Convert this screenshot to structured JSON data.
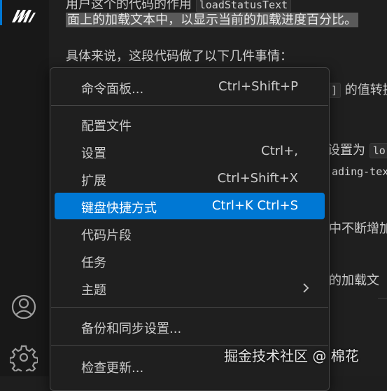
{
  "editor": {
    "line1_prefix": "用户这个的代码的作用",
    "line1_code": "loadStatusText",
    "line1_suffix": "",
    "line2": "面上的加载文本中，以显示当前的加载进度百分比。",
    "line3": "具体来说，这段代码做了以下几件事情：",
    "frag_code1": "]",
    "frag_text1": "的值转换",
    "frag_text2": "设置为",
    "frag_code2": "lo",
    "frag_code3": "ading-tex",
    "frag_text3": "中不断增加",
    "frag_text4": "的加载文"
  },
  "menu": {
    "items": [
      {
        "label": "命令面板...",
        "shortcut": "Ctrl+Shift+P"
      },
      {
        "label": "配置文件",
        "shortcut": ""
      },
      {
        "label": "设置",
        "shortcut": "Ctrl+,"
      },
      {
        "label": "扩展",
        "shortcut": "Ctrl+Shift+X"
      },
      {
        "label": "键盘快捷方式",
        "shortcut": "Ctrl+K Ctrl+S",
        "active": true
      },
      {
        "label": "代码片段",
        "shortcut": ""
      },
      {
        "label": "任务",
        "shortcut": ""
      },
      {
        "label": "主题",
        "shortcut": "",
        "submenu": true
      },
      {
        "label": "备份和同步设置...",
        "shortcut": ""
      },
      {
        "label": "检查更新...",
        "shortcut": ""
      }
    ]
  },
  "watermark": "掘金技术社区 @ 棉花",
  "colors": {
    "accent": "#0078d4",
    "background": "#1e1e1e",
    "menu_bg": "#1f1f1f"
  },
  "icons": [
    "app-logo-icon",
    "account-icon",
    "gear-icon",
    "chevron-right-icon"
  ]
}
